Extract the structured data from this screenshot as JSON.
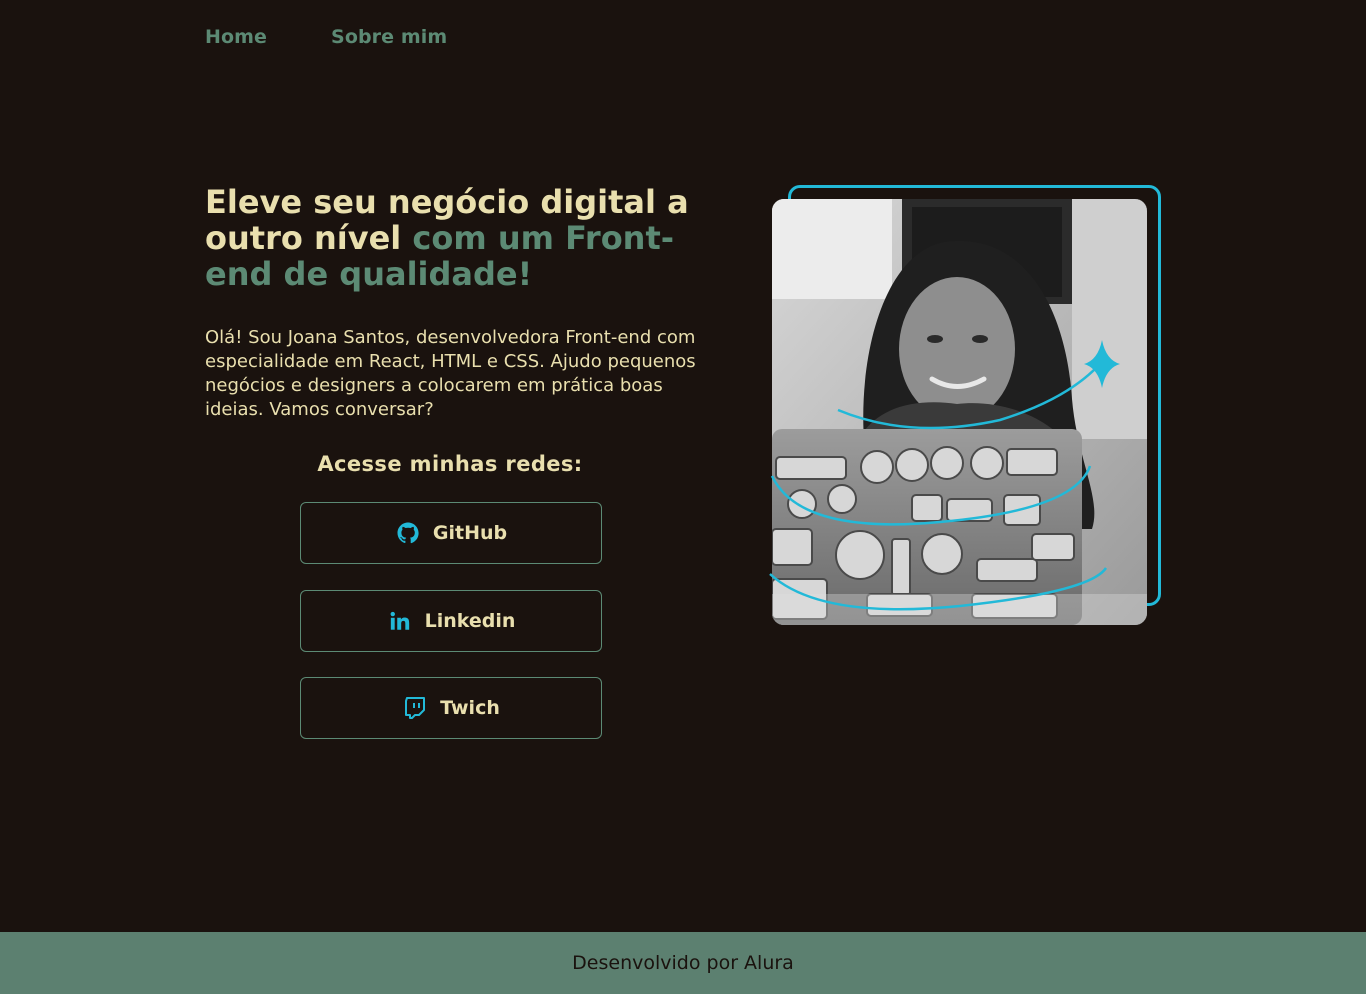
{
  "nav": {
    "items": [
      {
        "label": "Home"
      },
      {
        "label": "Sobre mim"
      }
    ]
  },
  "hero": {
    "headline_part1": "Eleve seu negócio digital a outro nível ",
    "headline_part2": "com um Front-end de qualidade!",
    "intro": "Olá! Sou Joana Santos, desenvolvedora Front-end com especialidade em React, HTML e CSS. Ajudo pequenos negócios e designers a colocarem em prática boas ideias. Vamos conversar?"
  },
  "socials": {
    "title": "Acesse minhas redes:",
    "links": [
      {
        "label": "GitHub",
        "icon": "github-icon"
      },
      {
        "label": "Linkedin",
        "icon": "linkedin-icon"
      },
      {
        "label": "Twich",
        "icon": "twitch-icon"
      }
    ]
  },
  "footer": {
    "text": "Desenvolvido por Alura"
  },
  "colors": {
    "background": "#1a120e",
    "cream": "#e9dfae",
    "green": "#5c8a74",
    "footer_bg": "#5c8070",
    "cyan": "#22b9d8"
  }
}
